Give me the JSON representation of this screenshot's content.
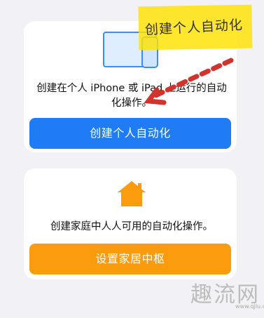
{
  "personal_card": {
    "description": "创建在个人 iPhone 或 iPad 上运行的自动化操作。",
    "button_label": "创建个人自动化"
  },
  "home_card": {
    "description": "创建家庭中人人可用的自动化操作。",
    "button_label": "设置家居中枢"
  },
  "annotation": {
    "handwritten_text": "创建个人自动化"
  },
  "watermark": {
    "text": "趣流网",
    "url": "www.qjlu.com"
  },
  "colors": {
    "background": "#f2f2f6",
    "primary_button": "#1f7cf4",
    "home_button": "#fb9b0e",
    "annotation_highlight": "#ffe200",
    "annotation_arrow": "#d0342c"
  },
  "icons": {
    "personal_card_icon": "iphone-ipad-icon",
    "home_card_icon": "house-icon",
    "annotation_icon": "arrow-icon"
  }
}
